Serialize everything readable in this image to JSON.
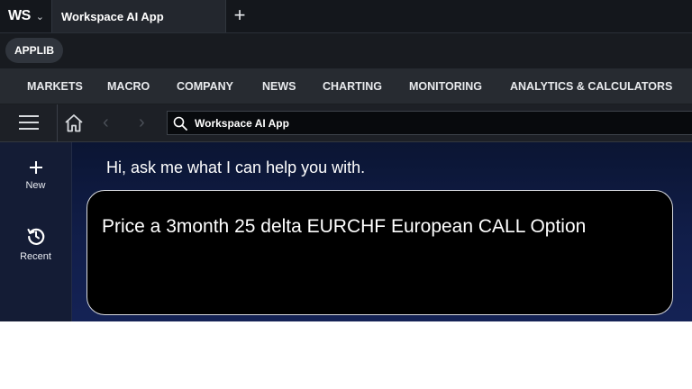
{
  "titlebar": {
    "logo": "WS",
    "tab_label": "Workspace AI App",
    "new_tab_label": "+"
  },
  "applib": {
    "label": "APPLIB"
  },
  "menu": {
    "items": [
      "MARKETS",
      "MACRO",
      "COMPANY",
      "NEWS",
      "CHARTING",
      "MONITORING",
      "ANALYTICS & CALCULATORS"
    ]
  },
  "toolbar": {
    "search_value": "Workspace AI App",
    "icons": [
      "hamburger-icon",
      "home-icon",
      "back-arrow-icon",
      "forward-arrow-icon",
      "search-icon"
    ]
  },
  "rail": {
    "new_label": "New",
    "recent_label": "Recent"
  },
  "chat": {
    "greeting": "Hi, ask me what I can help you with.",
    "prompt": "Price a 3month 25 delta EURCHF European CALL Option"
  },
  "colors": {
    "app_background": "#0f1217",
    "rail_background": "#141c35",
    "chat_gradient_top": "#0b1533",
    "chat_gradient_bottom": "#142255",
    "prompt_box": "#000000"
  }
}
